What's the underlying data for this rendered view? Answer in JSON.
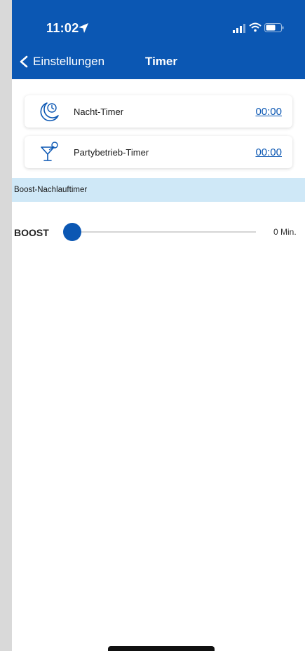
{
  "status_bar": {
    "time": "11:02"
  },
  "navigation": {
    "back_label": "Einstellungen",
    "title": "Timer"
  },
  "timers": [
    {
      "icon": "moon-clock-icon",
      "label": "Nacht-Timer",
      "value": "00:00"
    },
    {
      "icon": "cocktail-glass-icon",
      "label": "Partybetrieb-Timer",
      "value": "00:00"
    }
  ],
  "boost_section": {
    "heading": "Boost-Nachlauftimer",
    "slider_label": "BOOST",
    "slider_value_text": "0 Min.",
    "slider_fraction": 0.0
  },
  "colors": {
    "primary": "#0b57b3",
    "section_background": "#cfe8f7"
  }
}
